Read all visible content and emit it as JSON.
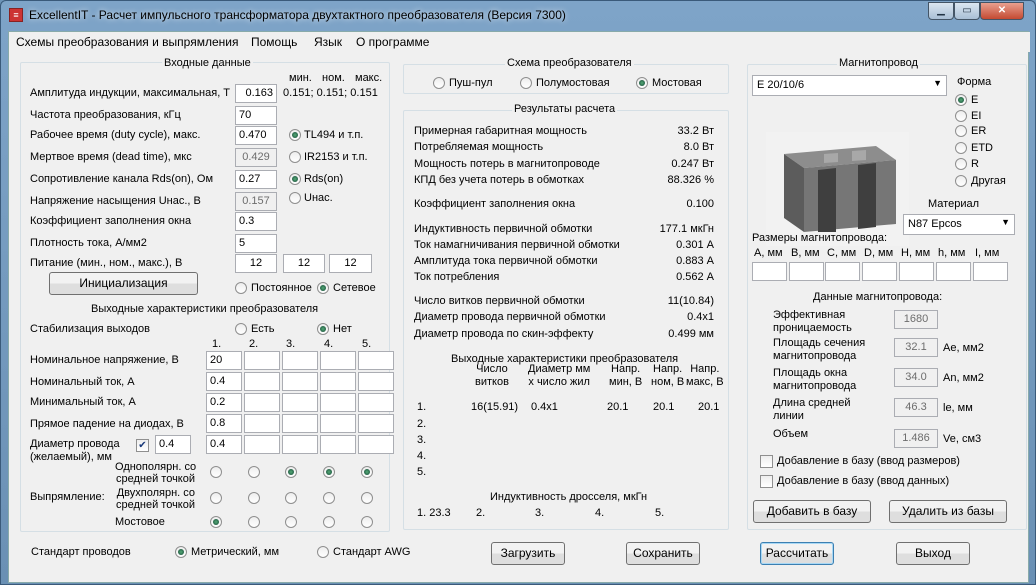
{
  "window": {
    "app_icon": "excellentit-icon",
    "title": "ExcellentIT - Расчет импульсного трансформатора двухтактного преобразователя (Версия 7300)",
    "buttons": [
      "minimize",
      "maximize",
      "close"
    ]
  },
  "menu": [
    "Схемы преобразования и выпрямления",
    "Помощь",
    "Язык",
    "О программе"
  ],
  "input": {
    "title": "Входные данные",
    "col_headers": [
      "мин.",
      "ном.",
      "макс."
    ],
    "induction_label": "Амплитуда индукции, максимальная, Т",
    "induction_value": "0.163",
    "induction_mnm": "0.151; 0.151; 0.151",
    "freq_label": "Частота преобразования, кГц",
    "freq_value": "70",
    "duty_label": "Рабочее время (duty cycle), макс.",
    "duty_value": "0.470",
    "dead_label": "Мертвое время (dead time), мкс",
    "dead_value": "0.429",
    "rds_label": "Сопротивление канала Rds(on), Ом",
    "rds_value": "0.27",
    "usat_label": "Напряжение насыщения Uнас., В",
    "usat_value": "0.157",
    "fill_label": "Коэффициент заполнения окна",
    "fill_value": "0.3",
    "current_label": "Плотность тока, А/мм2",
    "current_value": "5",
    "supply_label": "Питание (мин., ном., макс.), В",
    "supply_values": [
      "12",
      "12",
      "12"
    ],
    "ctrl_options": [
      "TL494 и т.п.",
      "IR2153 и т.п.",
      "Rds(on)",
      "Uнас."
    ],
    "ctrl_selected": [
      true,
      false,
      true,
      false
    ],
    "init_button": "Инициализация",
    "supply_type": [
      "Постоянное",
      "Сетевое"
    ],
    "supply_type_selected": 1
  },
  "output": {
    "title": "Выходные характеристики преобразователя",
    "stab_label": "Стабилизация выходов",
    "stab_options": [
      "Есть",
      "Нет"
    ],
    "stab_selected": 1,
    "columns": [
      "1.",
      "2.",
      "3.",
      "4.",
      "5."
    ],
    "voltage_label": "Номинальное напряжение, В",
    "voltage": [
      "20",
      "",
      "",
      "",
      ""
    ],
    "current_label": "Номинальный ток, А",
    "current": [
      "0.4",
      "",
      "",
      "",
      ""
    ],
    "min_current_label": "Минимальный ток, А",
    "min_current": [
      "0.2",
      "",
      "",
      "",
      ""
    ],
    "diode_label": "Прямое падение на диодах, В",
    "diode": [
      "0.8",
      "",
      "",
      "",
      ""
    ],
    "wire_label_1": "Диаметр провода",
    "wire_label_2": "(желаемый), мм",
    "wire_checked": true,
    "wire_desired": "0.4",
    "wire": [
      "0.4",
      "",
      "",
      "",
      ""
    ],
    "rect_label": "Выпрямление:",
    "rect_modes": [
      "Однополярн. со средней точкой",
      "Двухполярн. со средней точкой",
      "Мостовое"
    ],
    "rect_mode_lines": [
      [
        "Однополярн. со",
        "средней точкой"
      ],
      [
        "Двухполярн. со",
        "средней точкой"
      ],
      [
        "Мостовое"
      ]
    ],
    "rect_selected": [
      [
        false,
        false,
        true,
        true,
        true
      ],
      [
        false,
        false,
        false,
        false,
        false
      ],
      [
        true,
        false,
        false,
        false,
        false
      ]
    ]
  },
  "wire_std": {
    "label": "Стандарт проводов",
    "options": [
      "Метрический, мм",
      "Стандарт AWG"
    ],
    "selected": 0
  },
  "scheme": {
    "title": "Схема преобразователя",
    "options": [
      "Пуш-пул",
      "Полумостовая",
      "Мостовая"
    ],
    "selected": 2
  },
  "results": {
    "title": "Результаты расчета",
    "rows": [
      {
        "label": "Примерная габаритная мощность",
        "value": "33.2 Вт"
      },
      {
        "label": "Потребляемая мощность",
        "value": "8.0 Вт"
      },
      {
        "label": "Мощность потерь в магнитопроводе",
        "value": "0.247 Вт"
      },
      {
        "label": "КПД без учета потерь в обмотках",
        "value": "88.326 %"
      },
      {
        "label": "Коэффициент заполнения окна",
        "value": "0.100"
      },
      {
        "label": "Индуктивность первичной обмотки",
        "value": "177.1 мкГн"
      },
      {
        "label": "Ток намагничивания первичной обмотки",
        "value": "0.301 А"
      },
      {
        "label": "Амплитуда тока первичной обмотки",
        "value": "0.883 А"
      },
      {
        "label": "Ток потребления",
        "value": "0.562 А"
      },
      {
        "label": "Число витков первичной обмотки",
        "value": "11(10.84)"
      },
      {
        "label": "Диаметр провода первичной обмотки",
        "value": "0.4x1"
      },
      {
        "label": "Диаметр провода по скин-эффекту",
        "value": "0.499 мм"
      }
    ],
    "out_title": "Выходные характеристики преобразователя",
    "out_headers": [
      [
        "Число",
        "витков"
      ],
      [
        "Диаметр мм",
        "х число жил"
      ],
      [
        "Напр.",
        "мин, В"
      ],
      [
        "Напр.",
        "ном, В"
      ],
      [
        "Напр.",
        "макс, В"
      ]
    ],
    "out_rows": [
      {
        "n": "1.",
        "turns": "16(15.91)",
        "wire": "0.4x1",
        "vmin": "20.1",
        "vnom": "20.1",
        "vmax": "20.1"
      },
      {
        "n": "2.",
        "turns": "",
        "wire": "",
        "vmin": "",
        "vnom": "",
        "vmax": ""
      },
      {
        "n": "3.",
        "turns": "",
        "wire": "",
        "vmin": "",
        "vnom": "",
        "vmax": ""
      },
      {
        "n": "4.",
        "turns": "",
        "wire": "",
        "vmin": "",
        "vnom": "",
        "vmax": ""
      },
      {
        "n": "5.",
        "turns": "",
        "wire": "",
        "vmin": "",
        "vnom": "",
        "vmax": ""
      }
    ],
    "choke_title": "Индуктивность дросселя, мкГн",
    "choke": [
      "1. 23.3",
      "2.",
      "3.",
      "4.",
      "5."
    ]
  },
  "core": {
    "title": "Магнитопровод",
    "selected": "E 20/10/6",
    "form_title": "Форма",
    "forms": [
      "E",
      "EI",
      "ER",
      "ETD",
      "R",
      "Другая"
    ],
    "form_selected": 0,
    "material_title": "Материал",
    "material": "N87 Epcos",
    "dims_title": "Размеры магнитопровода:",
    "dims": [
      "A, мм",
      "B, мм",
      "C, мм",
      "D, мм",
      "H, мм",
      "h, мм",
      "I, мм"
    ],
    "data_title": "Данные магнитопровода:",
    "data": [
      {
        "label": [
          "Эффективная",
          "проницаемость"
        ],
        "value": "1680",
        "unit": ""
      },
      {
        "label": [
          "Площадь сечения",
          "магнитопровода"
        ],
        "value": "32.1",
        "unit": "Ae, мм2"
      },
      {
        "label": [
          "Площадь окна",
          "магнитопровода"
        ],
        "value": "34.0",
        "unit": "An, мм2"
      },
      {
        "label": [
          "Длина средней",
          "линии"
        ],
        "value": "46.3",
        "unit": "le, мм"
      },
      {
        "label": [
          "Объем"
        ],
        "value": "1.486",
        "unit": "Ve, см3"
      }
    ],
    "add_dims": "Добавление в базу (ввод размеров)",
    "add_data": "Добавление в базу (ввод данных)",
    "add_button": "Добавить в базу",
    "del_button": "Удалить из базы"
  },
  "bottom": {
    "load": "Загрузить",
    "save": "Сохранить",
    "calc": "Рассчитать",
    "exit": "Выход"
  }
}
